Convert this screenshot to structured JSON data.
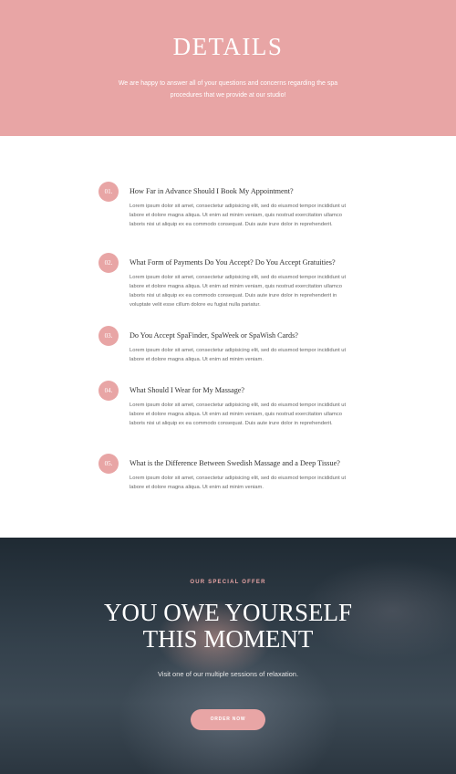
{
  "hero": {
    "title": "DETAILS",
    "subtitle": "We are happy to answer all of your questions and concerns regarding the spa procedures that we provide at our studio!"
  },
  "faq": [
    {
      "num": "01.",
      "question": "How Far in Advance Should I Book My Appointment?",
      "answer": "Lorem ipsum dolor sit amet, consectetur adipisicing elit, sed do eiusmod tempor incididunt ut labore et dolore magna aliqua. Ut enim ad minim veniam, quis nostrud exercitation ullamco laboris nisi ut aliquip ex ea commodo consequat. Duis aute irure dolor in reprehenderit."
    },
    {
      "num": "02.",
      "question": "What Form of Payments Do You Accept? Do You Accept Gratuities?",
      "answer": "Lorem ipsum dolor sit amet, consectetur adipisicing elit, sed do eiusmod tempor incididunt ut labore et dolore magna aliqua. Ut enim ad minim veniam, quis nostrud exercitation ullamco laboris nisi ut aliquip ex ea commodo consequat. Duis aute irure dolor in reprehenderit in voluptate velit esse cillum dolore eu fugiat nulla pariatur."
    },
    {
      "num": "03.",
      "question": "Do You Accept SpaFinder, SpaWeek or SpaWish Cards?",
      "answer": "Lorem ipsum dolor sit amet, consectetur adipisicing elit, sed do eiusmod tempor incididunt ut labore et dolore magna aliqua. Ut enim ad minim veniam."
    },
    {
      "num": "04.",
      "question": "What Should I Wear for My Massage?",
      "answer": "Lorem ipsum dolor sit amet, consectetur adipisicing elit, sed do eiusmod tempor incididunt ut labore et dolore magna aliqua. Ut enim ad minim veniam, quis nostrud exercitation ullamco laboris nisi ut aliquip ex ea commodo consequat. Duis aute irure dolor in reprehenderit."
    },
    {
      "num": "05.",
      "question": "What is the Difference Between Swedish Massage and a Deep Tissue?",
      "answer": "Lorem ipsum dolor sit amet, consectetur adipisicing elit, sed do eiusmod tempor incididunt ut labore et dolore magna aliqua. Ut enim ad minim veniam."
    }
  ],
  "promo": {
    "label": "OUR SPECIAL OFFER",
    "title_line1": "YOU OWE YOURSELF",
    "title_line2": "THIS MOMENT",
    "subtitle": "Visit one of our multiple sessions of relaxation.",
    "button": "ORDER NOW"
  },
  "colors": {
    "accent": "#e8a5a5",
    "heading_text": "#333333",
    "body_text": "#666666"
  }
}
